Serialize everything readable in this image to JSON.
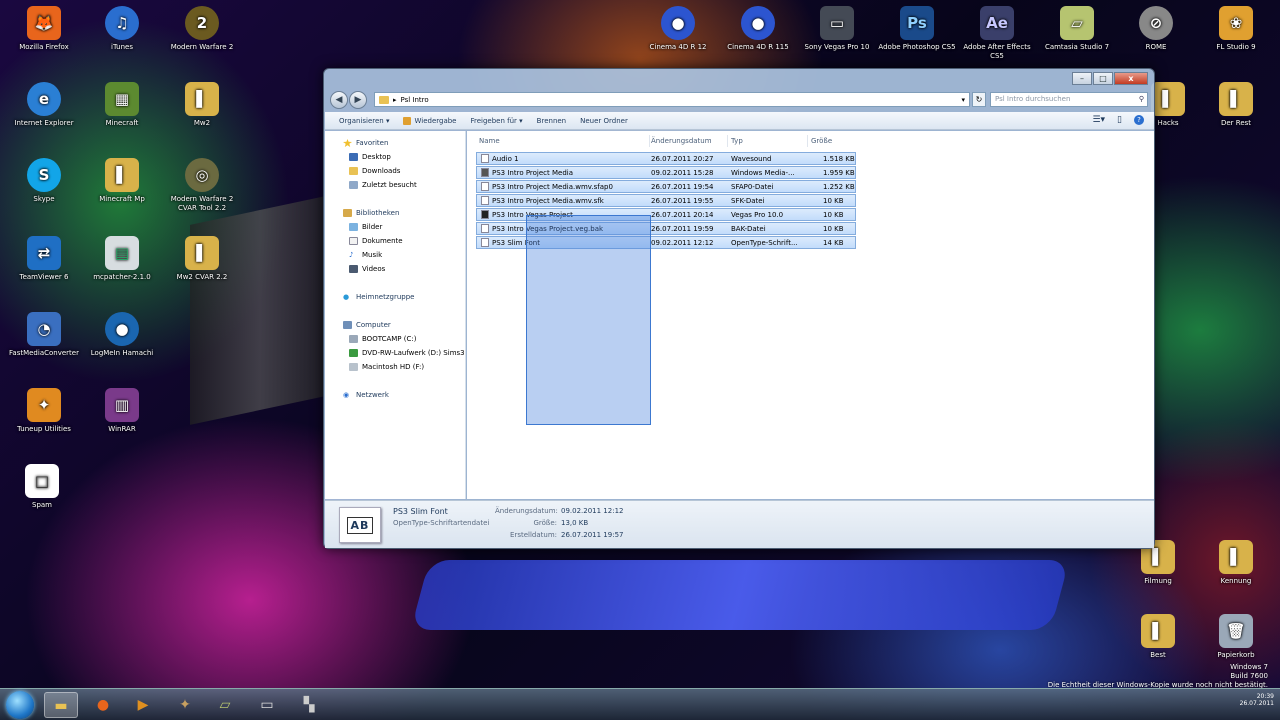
{
  "desktop": {
    "icons": [
      {
        "label": "Mozilla Firefox",
        "glyph": "🦊",
        "color": "#e8651c"
      },
      {
        "label": "iTunes",
        "glyph": "♫",
        "color": "#2a6ecf"
      },
      {
        "label": "Modern Warfare 2",
        "glyph": "2",
        "color": "#6b5a20"
      },
      {
        "label": "Internet Explorer",
        "glyph": "e",
        "color": "#2a7fd4"
      },
      {
        "label": "Minecraft",
        "glyph": "▦",
        "color": "#5c8a30"
      },
      {
        "label": "Mw2",
        "glyph": "▌",
        "color": "#d8b24a"
      },
      {
        "label": "Skype",
        "glyph": "S",
        "color": "#12a5e8"
      },
      {
        "label": "Minecraft Mp",
        "glyph": "▌",
        "color": "#d8b24a"
      },
      {
        "label": "Modern Warfare 2 CVAR Tool 2.2",
        "glyph": "◎",
        "color": "#6b6a40"
      },
      {
        "label": "TeamViewer 6",
        "glyph": "⇄",
        "color": "#1f6fc4"
      },
      {
        "label": "mcpatcher-2.1.0",
        "glyph": "▤",
        "color": "#d7dde0"
      },
      {
        "label": "Mw2 CVAR 2.2",
        "glyph": "▌",
        "color": "#d8b24a"
      },
      {
        "label": "FastMediaConverter",
        "glyph": "◔",
        "color": "#3a6fc0"
      },
      {
        "label": "LogMeIn Hamachi",
        "glyph": "●",
        "color": "#1a66b0"
      },
      {
        "label": "Tuneup Utilities",
        "glyph": "✦",
        "color": "#e08a20"
      },
      {
        "label": "WinRAR",
        "glyph": "▥",
        "color": "#7a3a8a"
      },
      {
        "label": "Spam",
        "glyph": "□",
        "color": "#ffffff"
      },
      {
        "label": "Cinema 4D R 12",
        "glyph": "●",
        "color": "#2c55d0"
      },
      {
        "label": "Cinema 4D R 115",
        "glyph": "●",
        "color": "#2c55d0"
      },
      {
        "label": "Sony Vegas Pro 10",
        "glyph": "▭",
        "color": "#444a55"
      },
      {
        "label": "Adobe Photoshop CS5",
        "glyph": "Ps",
        "color": "#1a4a8a"
      },
      {
        "label": "Adobe After Effects CS5",
        "glyph": "Ae",
        "color": "#3a3f6a"
      },
      {
        "label": "Camtasia Studio 7",
        "glyph": "▱",
        "color": "#b6c470"
      },
      {
        "label": "ROME",
        "glyph": "⊘",
        "color": "#888888"
      },
      {
        "label": "FL Studio 9",
        "glyph": "❀",
        "color": "#e0a030"
      },
      {
        "label": "Hacks",
        "glyph": "▌",
        "color": "#d8b24a"
      },
      {
        "label": "Der Rest",
        "glyph": "▌",
        "color": "#d8b24a"
      },
      {
        "label": "Filmung",
        "glyph": "▌",
        "color": "#d8b24a"
      },
      {
        "label": "Kennung",
        "glyph": "▌",
        "color": "#d8b24a"
      },
      {
        "label": "Best",
        "glyph": "▌",
        "color": "#d8b24a"
      },
      {
        "label": "Papierkorb",
        "glyph": "🗑",
        "color": "#9aa8b8"
      }
    ]
  },
  "window": {
    "address_path": "Psl Intro",
    "search_placeholder": "Psl Intro durchsuchen",
    "caption": {
      "minimize": "–",
      "maximize": "□",
      "close": "x"
    },
    "toolbar": {
      "organize": "Organisieren ▾",
      "play": "Wiedergabe",
      "share": "Freigeben für ▾",
      "burn": "Brennen",
      "new_folder": "Neuer Ordner"
    },
    "nav": {
      "favorites": "Favoriten",
      "desktop": "Desktop",
      "downloads": "Downloads",
      "recent": "Zuletzt besucht",
      "libraries": "Bibliotheken",
      "pictures": "Bilder",
      "documents": "Dokumente",
      "music": "Musik",
      "videos": "Videos",
      "homegroup": "Heimnetzgruppe",
      "computer": "Computer",
      "drive_c": "BOOTCAMP (C:)",
      "drive_d": "DVD-RW-Laufwerk (D:) Sims3",
      "drive_f": "Macintosh HD (F:)",
      "network": "Netzwerk"
    },
    "columns": {
      "name": "Name",
      "date": "Änderungsdatum",
      "type": "Typ",
      "size": "Größe"
    },
    "files": [
      {
        "name": "Audio 1",
        "date": "26.07.2011 20:27",
        "type": "Wavesound",
        "size": "1.518 KB"
      },
      {
        "name": "PS3 Intro Project Media",
        "date": "09.02.2011 15:28",
        "type": "Windows Media-...",
        "size": "1.959 KB"
      },
      {
        "name": "PS3 Intro Project Media.wmv.sfap0",
        "date": "26.07.2011 19:54",
        "type": "SFAP0-Datei",
        "size": "1.252 KB"
      },
      {
        "name": "PS3 Intro Project Media.wmv.sfk",
        "date": "26.07.2011 19:55",
        "type": "SFK-Datei",
        "size": "10 KB"
      },
      {
        "name": "PS3 Intro Vegas Project",
        "date": "26.07.2011 20:14",
        "type": "Vegas Pro 10.0",
        "size": "10 KB"
      },
      {
        "name": "PS3 Intro Vegas Project.veg.bak",
        "date": "26.07.2011 19:59",
        "type": "BAK-Datei",
        "size": "10 KB"
      },
      {
        "name": "PS3 Slim Font",
        "date": "09.02.2011 12:12",
        "type": "OpenType-Schrift...",
        "size": "14 KB"
      }
    ],
    "details": {
      "thumb": "AB",
      "name": "PS3 Slim Font",
      "kind": "OpenType-Schriftartendatei",
      "mod_label": "Änderungsdatum:",
      "mod_value": "09.02.2011 12:12",
      "size_label": "Größe:",
      "size_value": "13,0 KB",
      "created_label": "Erstelldatum:",
      "created_value": "26.07.2011 19:57"
    }
  },
  "taskbar": {
    "time": "20:39",
    "date": "26.07.2011"
  },
  "watermark": {
    "line1": "Windows 7",
    "line2": "Build 7600",
    "line3": "Die Echtheit dieser Windows-Kopie wurde noch nicht bestätigt."
  }
}
